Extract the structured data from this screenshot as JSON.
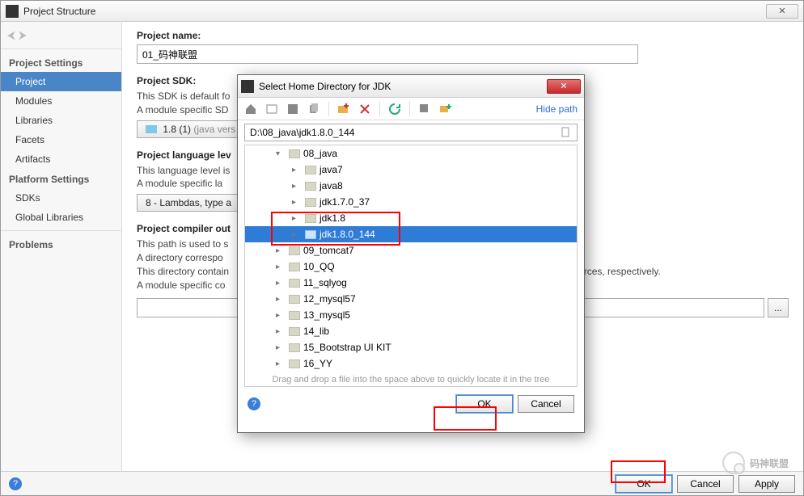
{
  "window": {
    "title": "Project Structure",
    "close": "✕"
  },
  "sidebar": {
    "heading1": "Project Settings",
    "items1": [
      "Project",
      "Modules",
      "Libraries",
      "Facets",
      "Artifacts"
    ],
    "heading2": "Platform Settings",
    "items2": [
      "SDKs",
      "Global Libraries"
    ],
    "heading3": "Problems"
  },
  "main": {
    "projectNameLabel": "Project name:",
    "projectName": "01_码神联盟",
    "sdkLabel": "Project SDK:",
    "sdkDesc1": "This SDK is default fo",
    "sdkDesc2": "A module specific SD",
    "sdkValue": "1.8 (1)",
    "sdkValueGrey": "(java vers",
    "langLabel": "Project language lev",
    "langDesc1": "This language level is",
    "langDesc2": "A module specific la",
    "langValue": "8 - Lambdas, type a",
    "outLabel": "Project compiler out",
    "outDesc1": "This path is used to s",
    "outDesc2": "A directory correspo",
    "outDesc3": "This directory contain",
    "outDesc3b": "urces, respectively.",
    "outDesc4": "A module specific co",
    "browseBtn": "..."
  },
  "dialog": {
    "title": "Select Home Directory for JDK",
    "hidePath": "Hide path",
    "path": "D:\\08_java\\jdk1.8.0_144",
    "root": "08_java",
    "children": [
      "java7",
      "java8",
      "jdk1.7.0_37",
      "jdk1.8",
      "jdk1.8.0_144",
      "09_tomcat7",
      "10_QQ",
      "11_sqlyog",
      "12_mysql57",
      "13_mysql5",
      "14_lib",
      "15_Bootstrap UI KIT",
      "16_YY"
    ],
    "selectedIdx": 4,
    "tomcatIdx": 5,
    "footer": "Drag and drop a file into the space above to quickly locate it in the tree",
    "ok": "OK",
    "cancel": "Cancel"
  },
  "bottom": {
    "ok": "OK",
    "cancel": "Cancel",
    "apply": "Apply"
  },
  "watermark": "码神联盟"
}
